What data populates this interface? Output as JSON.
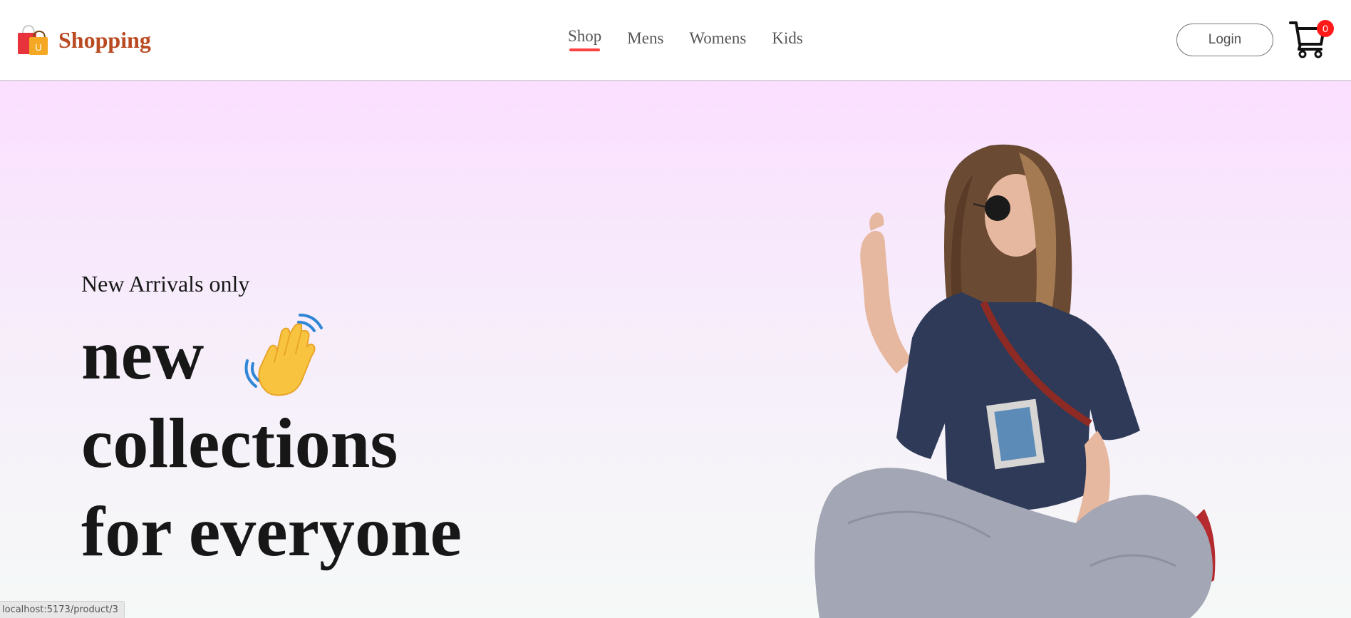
{
  "brand": {
    "name": "Shopping",
    "icon": "shopping-bag-icon",
    "color": "#b94a22"
  },
  "nav": {
    "items": [
      {
        "label": "Shop",
        "active": true
      },
      {
        "label": "Mens",
        "active": false
      },
      {
        "label": "Womens",
        "active": false
      },
      {
        "label": "Kids",
        "active": false
      }
    ],
    "active_underline_color": "#ff4141",
    "login_label": "Login",
    "cart": {
      "icon": "cart-icon",
      "count": "0"
    }
  },
  "hero": {
    "kicker": "New Arrivals only",
    "title_lines": [
      "new",
      "collections",
      "for everyone"
    ],
    "wave_icon": "waving-hand-icon",
    "image": "hero-model-photo"
  },
  "status_bar": {
    "url": "localhost:5173/product/3"
  }
}
